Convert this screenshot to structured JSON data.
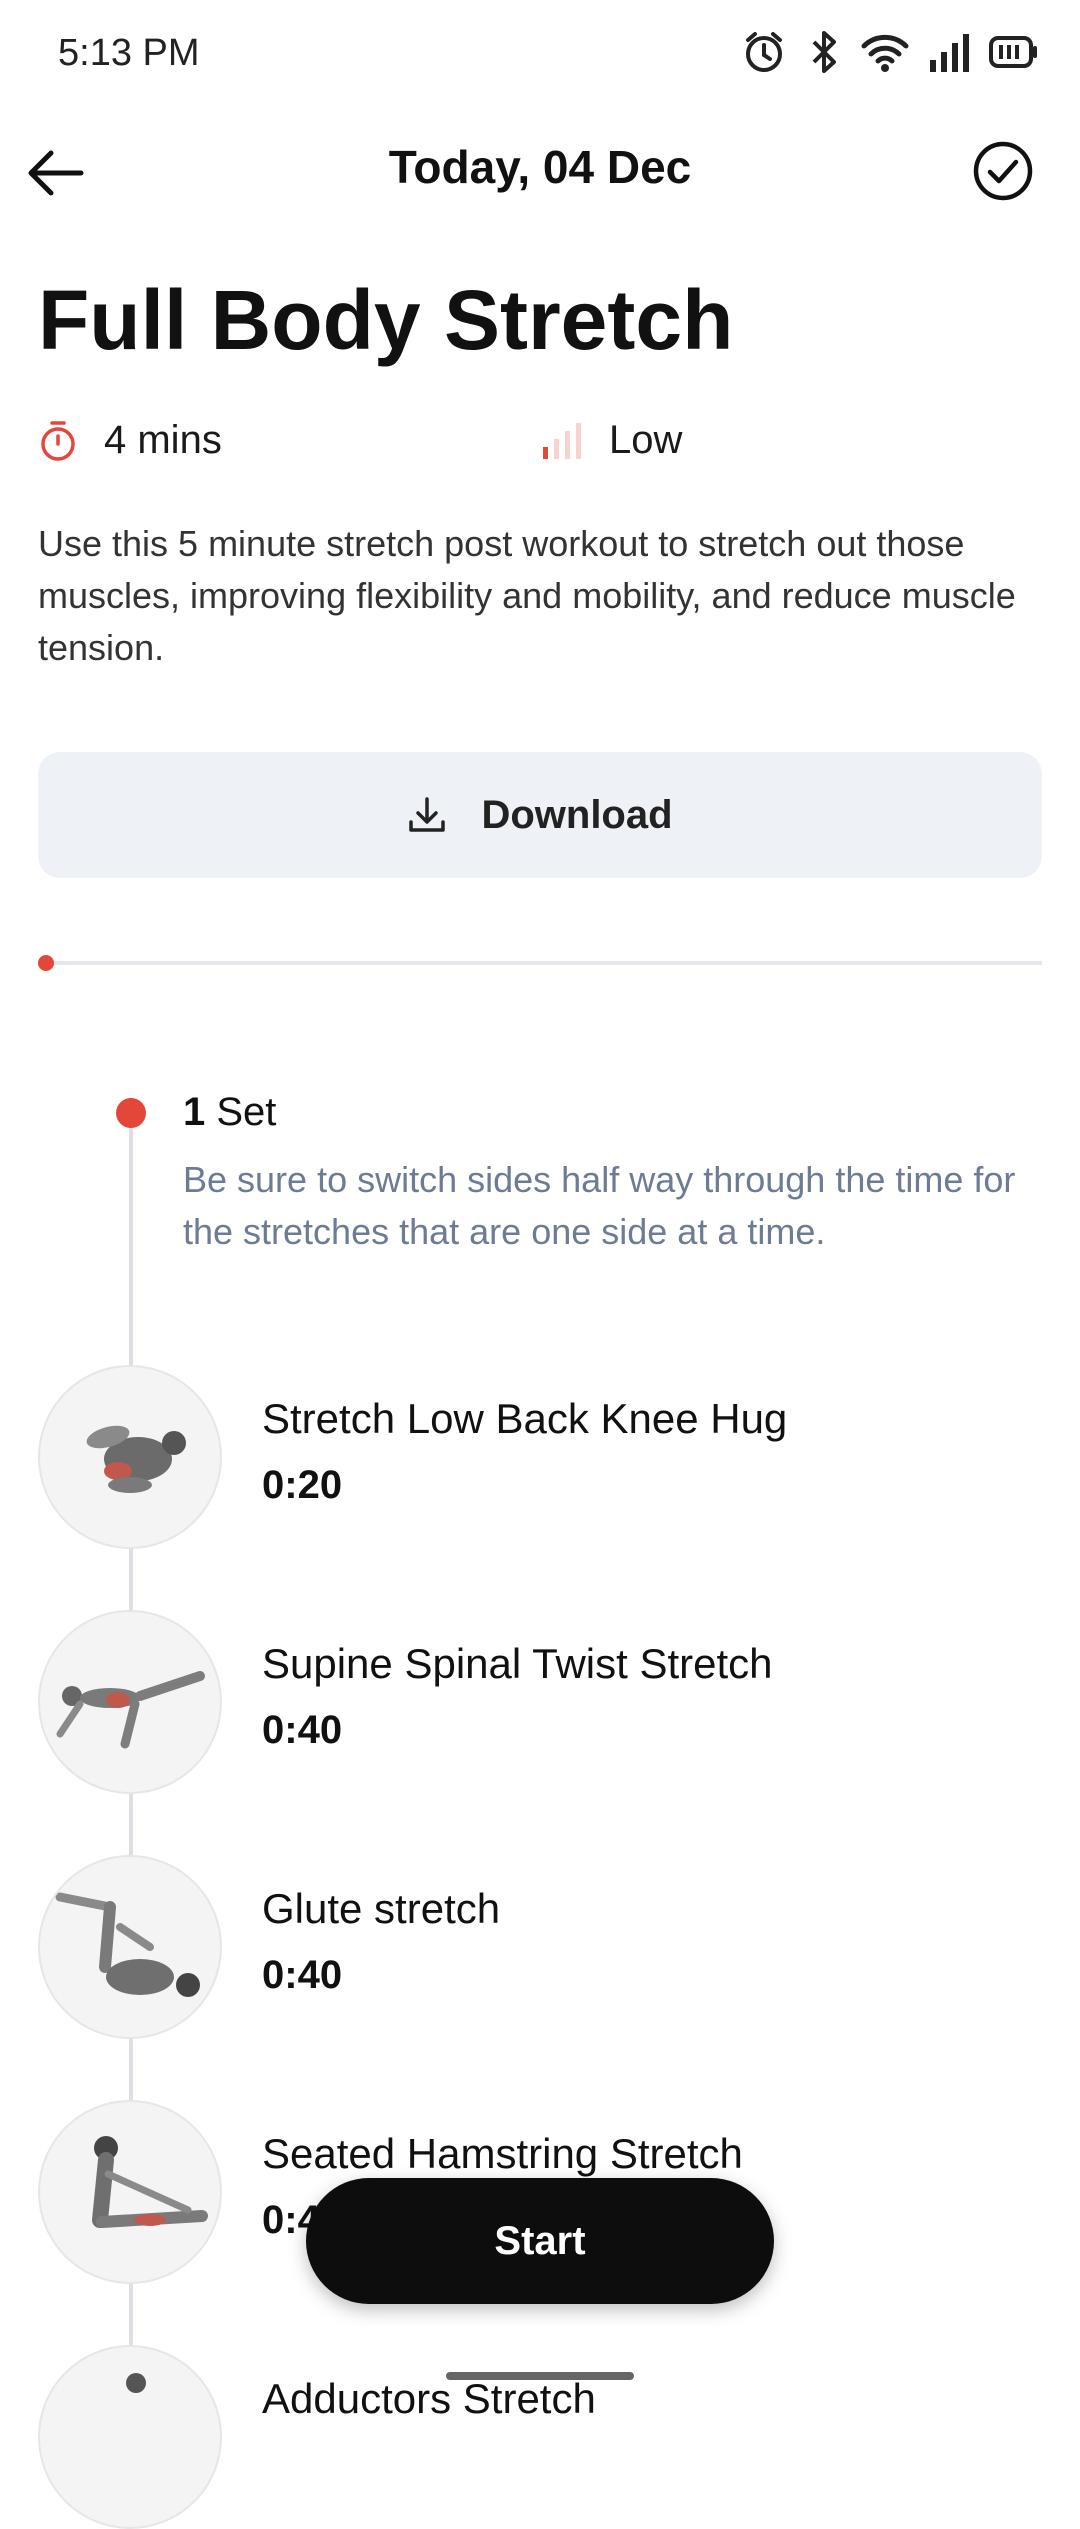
{
  "status_bar": {
    "time": "5:13 PM",
    "icons": [
      "alarm-icon",
      "bluetooth-icon",
      "wifi-icon",
      "signal-icon",
      "battery-icon"
    ]
  },
  "header": {
    "title": "Today, 04 Dec",
    "back_icon": "arrow-left-icon",
    "action_icon": "check-circle-icon"
  },
  "workout": {
    "title": "Full Body Stretch",
    "duration": "4 mins",
    "intensity": "Low",
    "description": "Use this 5 minute stretch post workout to stretch out those muscles, improving flexibility and mobility, and reduce muscle tension."
  },
  "download": {
    "label": "Download",
    "icon": "download-icon"
  },
  "progress": {
    "fraction": 0
  },
  "set": {
    "count": "1",
    "label": "Set",
    "note": "Be sure to switch sides half way through the time for the stretches that are one side at a time."
  },
  "exercises": [
    {
      "name": "Stretch Low Back Knee Hug",
      "duration": "0:20"
    },
    {
      "name": "Supine Spinal Twist Stretch",
      "duration": "0:40"
    },
    {
      "name": "Glute stretch",
      "duration": "0:40"
    },
    {
      "name": "Seated Hamstring Stretch",
      "duration": "0:40"
    },
    {
      "name": "Adductors Stretch",
      "duration": ""
    }
  ],
  "start_label": "Start",
  "colors": {
    "accent": "#e3473a",
    "note_text": "#6d7b94",
    "download_bg": "#eef1f5",
    "start_bg": "#0d0d0d"
  }
}
